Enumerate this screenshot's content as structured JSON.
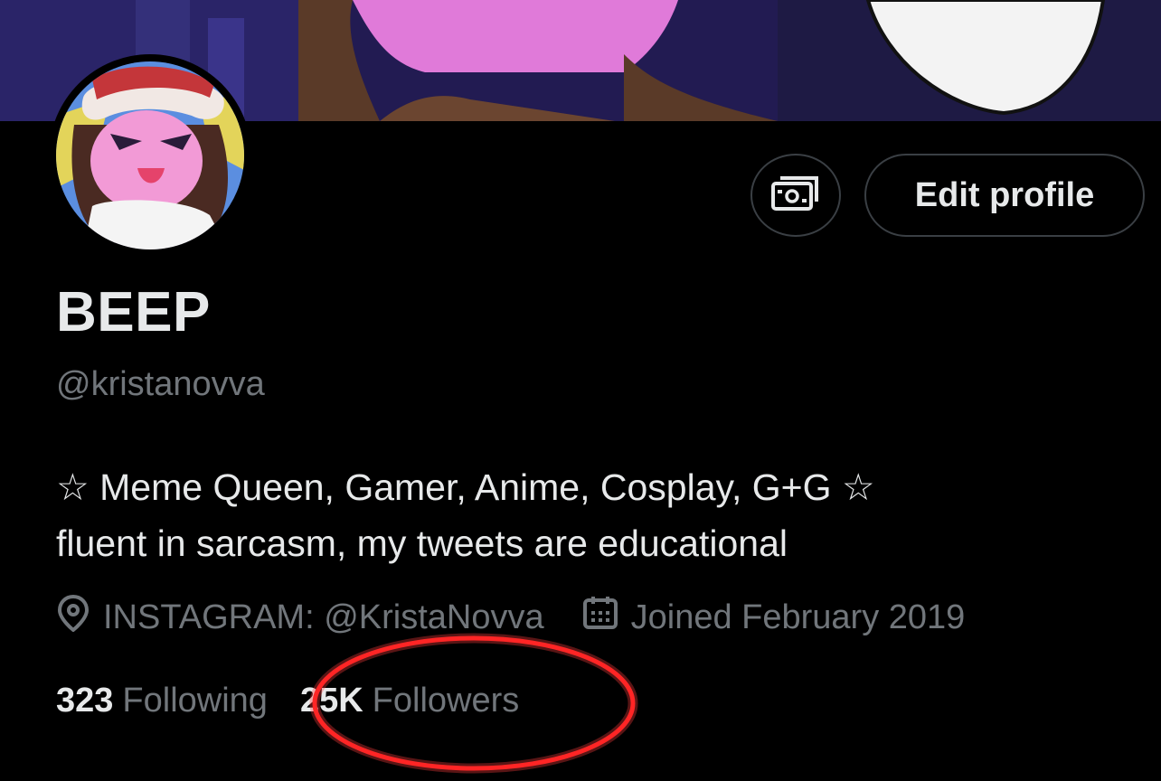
{
  "profile": {
    "display_name": "BEEP",
    "handle": "@kristanovva",
    "bio_lines": [
      "☆ Meme Queen, Gamer, Anime, Cosplay, G+G ☆",
      "fluent in sarcasm, my tweets are educational"
    ],
    "location": "INSTAGRAM: @KristaNovva",
    "joined": "Joined February 2019"
  },
  "actions": {
    "edit_profile_label": "Edit profile",
    "tips_icon": "money-icon"
  },
  "stats": {
    "following_count": "323",
    "following_label": "Following",
    "followers_count": "25K",
    "followers_label": "Followers"
  },
  "icons": {
    "location": "location-pin-icon",
    "calendar": "calendar-icon"
  },
  "colors": {
    "background": "#000000",
    "primary_text": "#e7e9ea",
    "secondary_text": "#71767b",
    "button_border": "#3a3f44",
    "highlight_circle": "#ff1a1a"
  }
}
